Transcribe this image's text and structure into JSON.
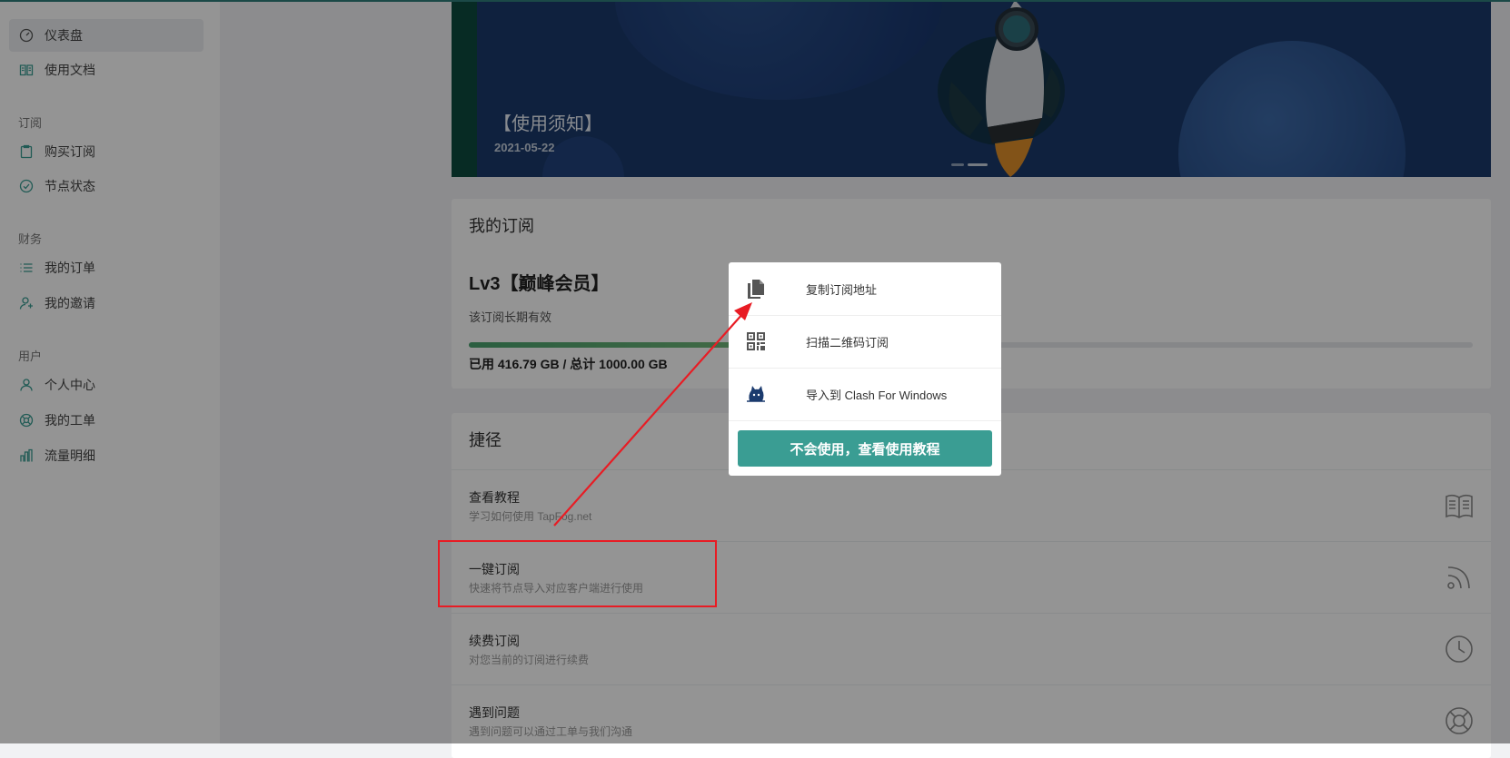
{
  "sidebar": {
    "items": [
      {
        "label": "仪表盘",
        "icon": "dashboard-icon",
        "active": true
      },
      {
        "label": "使用文档",
        "icon": "book-icon"
      }
    ],
    "sections": [
      {
        "title": "订阅",
        "items": [
          {
            "label": "购买订阅",
            "icon": "clipboard-icon"
          },
          {
            "label": "节点状态",
            "icon": "check-circle-icon"
          }
        ]
      },
      {
        "title": "财务",
        "items": [
          {
            "label": "我的订单",
            "icon": "list-icon"
          },
          {
            "label": "我的邀请",
            "icon": "user-invite-icon"
          }
        ]
      },
      {
        "title": "用户",
        "items": [
          {
            "label": "个人中心",
            "icon": "user-icon"
          },
          {
            "label": "我的工单",
            "icon": "support-icon"
          },
          {
            "label": "流量明细",
            "icon": "bar-chart-icon"
          }
        ]
      }
    ]
  },
  "banner": {
    "title": "【使用须知】",
    "date": "2021-05-22"
  },
  "subscription": {
    "title": "我的订阅",
    "plan": "Lv3【巅峰会员】",
    "validity": "该订阅长期有效",
    "usage_text": "已用 416.79 GB / 总计 1000.00 GB",
    "usage_fraction": 0.4168
  },
  "shortcuts": {
    "title": "捷径",
    "items": [
      {
        "title": "查看教程",
        "desc": "学习如何使用 TapFog.net",
        "icon": "book-open-icon"
      },
      {
        "title": "一键订阅",
        "desc": "快速将节点导入对应客户端进行使用",
        "icon": "rss-icon"
      },
      {
        "title": "续费订阅",
        "desc": "对您当前的订阅进行续费",
        "icon": "clock-icon"
      },
      {
        "title": "遇到问题",
        "desc": "遇到问题可以通过工单与我们沟通",
        "icon": "lifebuoy-icon"
      }
    ]
  },
  "popup": {
    "items": [
      {
        "label": "复制订阅地址",
        "icon": "copy-icon"
      },
      {
        "label": "扫描二维码订阅",
        "icon": "qrcode-icon"
      },
      {
        "label": "导入到 Clash For Windows",
        "icon": "clash-cat-icon"
      }
    ],
    "button": "不会使用，查看使用教程"
  },
  "colors": {
    "accent": "#3a9d93",
    "annotation": "#e81c24",
    "banner": "#1a3a6b"
  }
}
